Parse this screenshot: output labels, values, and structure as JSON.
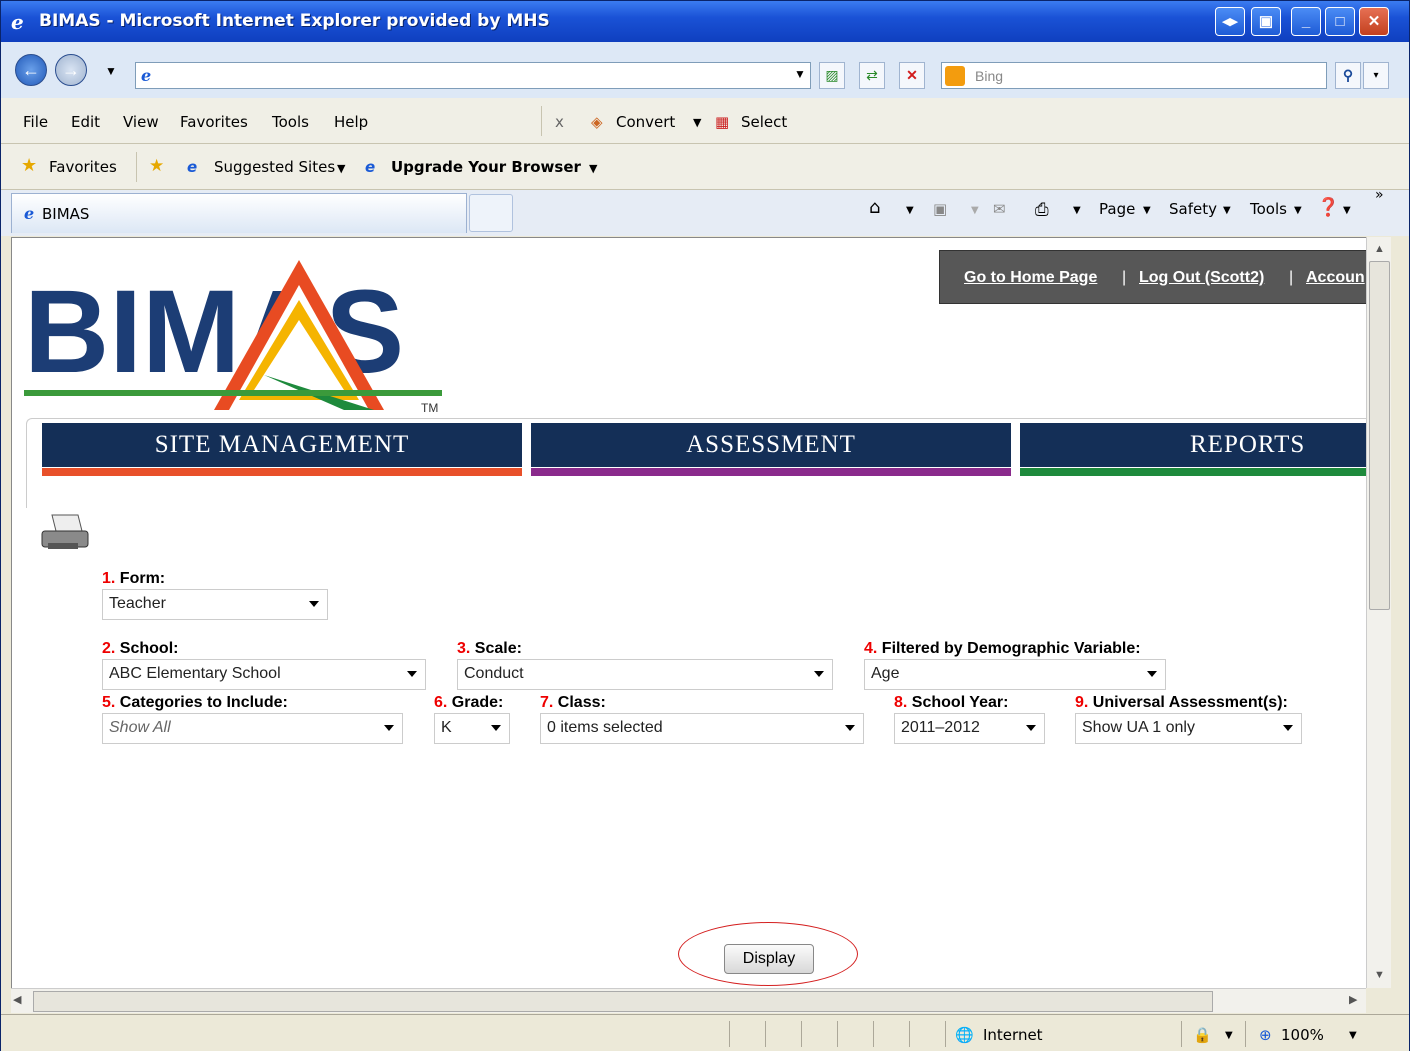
{
  "window": {
    "title": "BIMAS - Microsoft Internet Explorer provided by MHS"
  },
  "search": {
    "placeholder": "Bing"
  },
  "menu": [
    "File",
    "Edit",
    "View",
    "Favorites",
    "Tools",
    "Help"
  ],
  "toolbar": {
    "close_x": "x",
    "convert": "Convert",
    "select": "Select"
  },
  "favorites": {
    "label": "Favorites",
    "suggested": "Suggested Sites",
    "upgrade": "Upgrade Your Browser"
  },
  "tab": {
    "title": "BIMAS"
  },
  "commandbar": {
    "page": "Page",
    "safety": "Safety",
    "tools": "Tools"
  },
  "status": {
    "zone": "Internet",
    "zoom": "100%"
  },
  "page": {
    "logo_text": "BIMAS",
    "logo_tm": "TM",
    "links": {
      "home": "Go to Home Page",
      "logout": "Log Out (Scott2)",
      "account": "Accoun"
    },
    "nav": [
      "SITE MANAGEMENT",
      "ASSESSMENT",
      "REPORTS"
    ],
    "nav_colors": [
      "#e8502a",
      "#8a2a8c",
      "#1e8a3c"
    ],
    "fields": {
      "form": {
        "num": "1.",
        "label": "Form:",
        "value": "Teacher"
      },
      "school": {
        "num": "2.",
        "label": "School:",
        "value": "ABC Elementary School"
      },
      "scale": {
        "num": "3.",
        "label": "Scale:",
        "value": "Conduct"
      },
      "filter": {
        "num": "4.",
        "label": "Filtered by Demographic Variable:",
        "value": "Age"
      },
      "categories": {
        "num": "5.",
        "label": "Categories to Include:",
        "value": "Show All"
      },
      "grade": {
        "num": "6.",
        "label": "Grade:",
        "value": "K"
      },
      "class": {
        "num": "7.",
        "label": "Class:",
        "value": "0 items selected"
      },
      "year": {
        "num": "8.",
        "label": "School Year:",
        "value": "2011–2012"
      },
      "ua": {
        "num": "9.",
        "label": "Universal Assessment(s):",
        "value": "Show UA 1 only"
      }
    },
    "display_button": "Display"
  }
}
